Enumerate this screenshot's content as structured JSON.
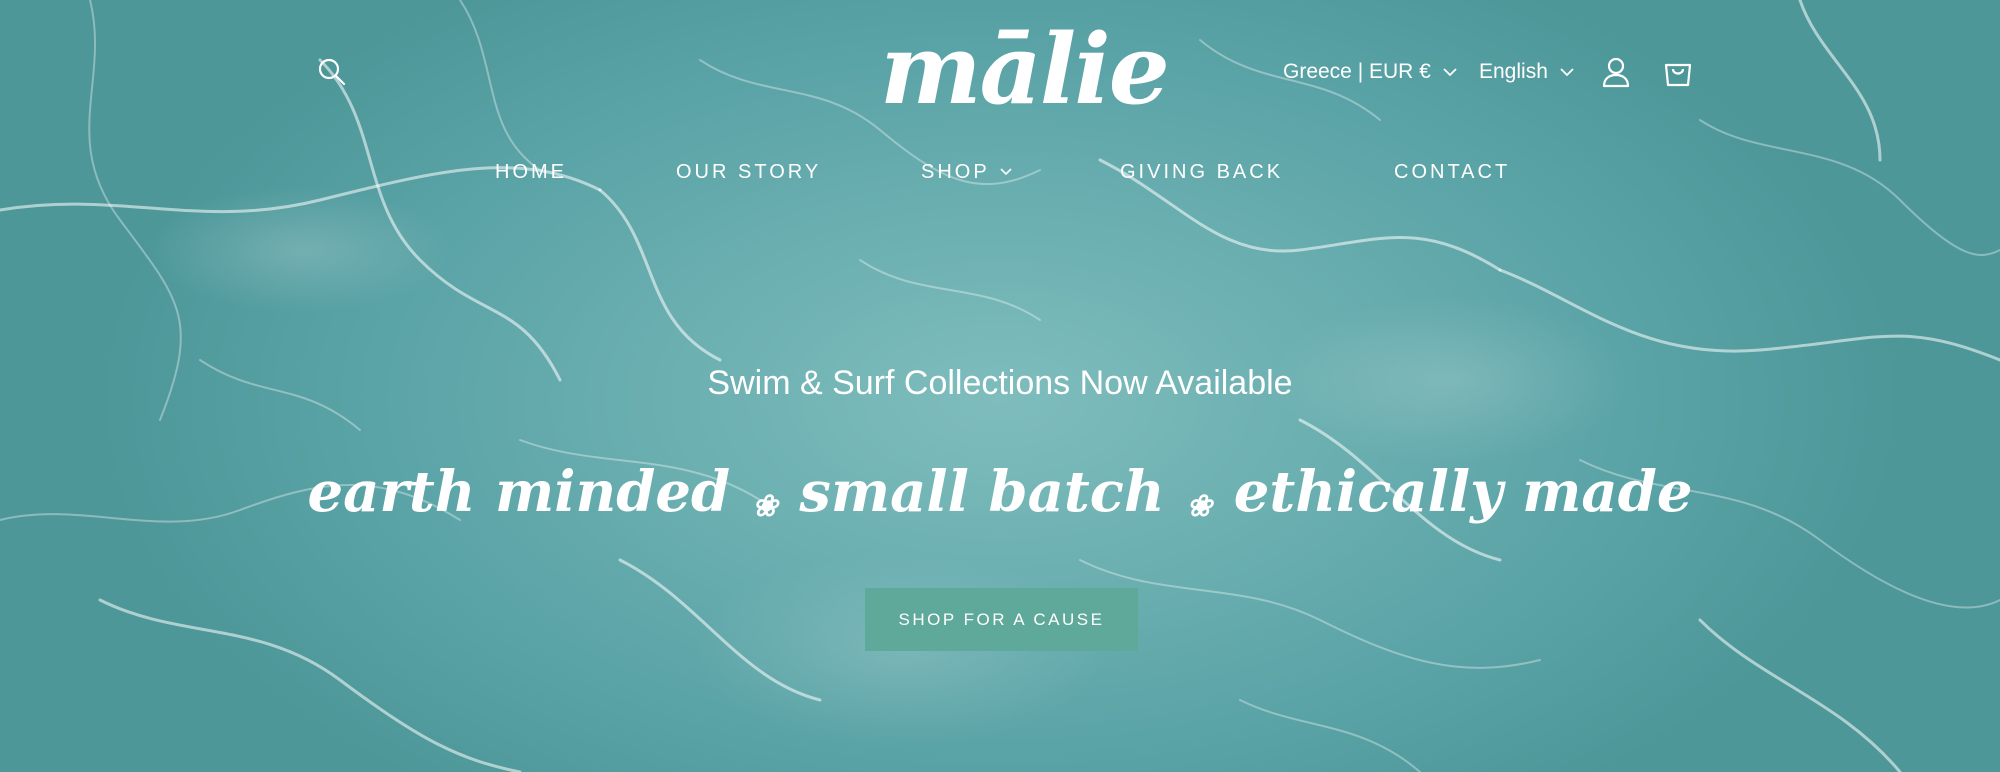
{
  "header": {
    "logo_text": "mālie",
    "country_selector": "Greece | EUR €",
    "language_selector": "English",
    "icons": {
      "search": "search-icon",
      "account": "account-icon",
      "cart": "cart-icon",
      "chevron": "chevron-down-icon"
    }
  },
  "nav": {
    "home": "HOME",
    "our_story": "OUR STORY",
    "shop": "SHOP",
    "giving_back": "GIVING BACK",
    "contact": "CONTACT"
  },
  "hero": {
    "subtitle": "Swim & Surf Collections Now Available",
    "tagline_1": "earth minded",
    "tagline_2": "small batch",
    "tagline_3": "ethically made",
    "separator": "❀",
    "cta_label": "SHOP FOR A CAUSE"
  },
  "colors": {
    "water": "#6fb1b3",
    "cta_background": "#5ea99a",
    "text": "#ffffff"
  }
}
